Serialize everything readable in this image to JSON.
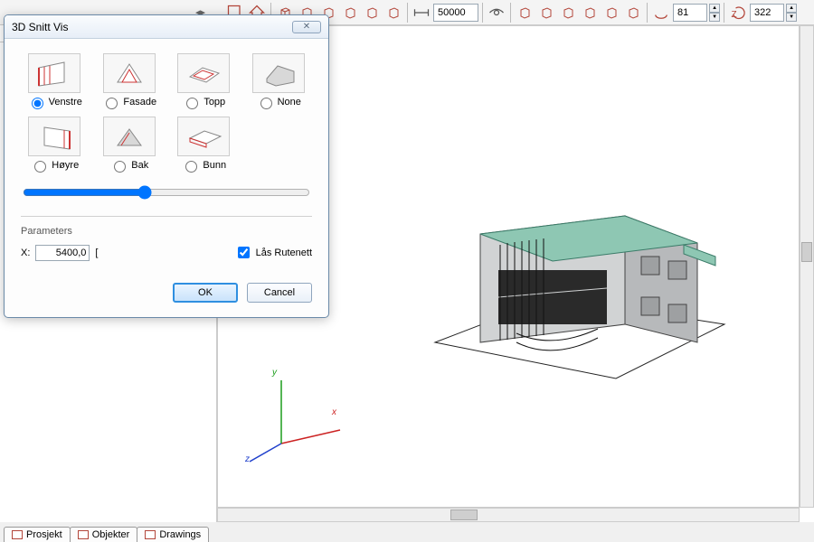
{
  "toolbar": {
    "scale_value": "50000",
    "num1_value": "81",
    "num2_value": "322"
  },
  "dialog": {
    "title": "3D Snitt Vis",
    "views": {
      "venstre": "Venstre",
      "fasade": "Fasade",
      "topp": "Topp",
      "none": "None",
      "hoyre": "Høyre",
      "bak": "Bak",
      "bunn": "Bunn"
    },
    "selected_view": "venstre",
    "parameters_label": "Parameters",
    "x_label": "X:",
    "x_value": "5400,0",
    "bracket": "[",
    "lock_grid_label": "Lås Rutenett",
    "lock_grid_checked": true,
    "ok_label": "OK",
    "cancel_label": "Cancel"
  },
  "axis": {
    "x": "x",
    "y": "y",
    "z": "z"
  },
  "tabs": {
    "prosjekt": "Prosjekt",
    "objekter": "Objekter",
    "drawings": "Drawings"
  }
}
